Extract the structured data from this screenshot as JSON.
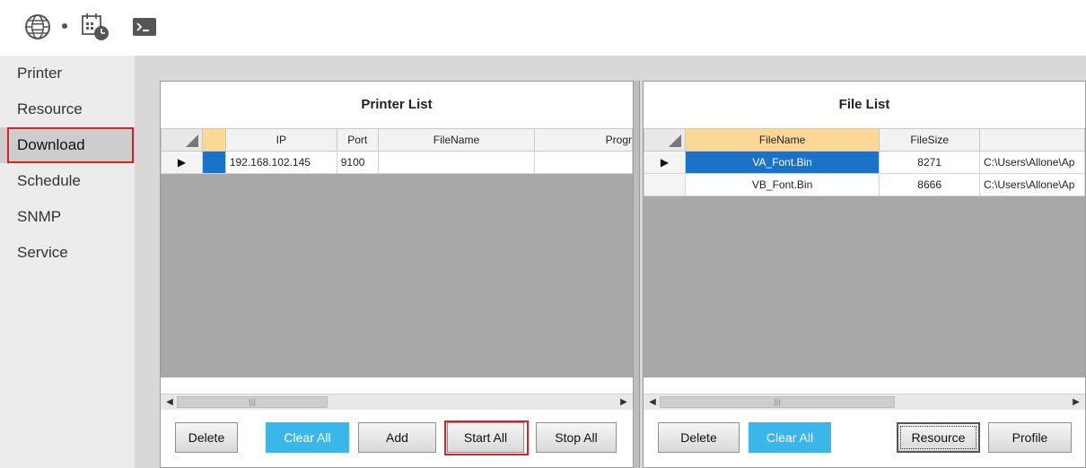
{
  "toolbar": {
    "icons": [
      "globe-language-icon",
      "dropdown-dot-icon",
      "calendar-clock-icon",
      "terminal-icon"
    ]
  },
  "sidebar": {
    "items": [
      {
        "label": "Printer",
        "active": false
      },
      {
        "label": "Resource",
        "active": false
      },
      {
        "label": "Download",
        "active": true
      },
      {
        "label": "Schedule",
        "active": false
      },
      {
        "label": "SNMP",
        "active": false
      },
      {
        "label": "Service",
        "active": false
      }
    ]
  },
  "printer_list": {
    "title": "Printer List",
    "columns": [
      "IP",
      "Port",
      "FileName",
      "Progr"
    ],
    "rows": [
      {
        "ip": "192.168.102.145",
        "port": "9100",
        "filename": "",
        "progress": ""
      }
    ],
    "buttons": {
      "delete": "Delete",
      "clear_all": "Clear All",
      "add": "Add",
      "start_all": "Start All",
      "stop_all": "Stop All"
    }
  },
  "file_list": {
    "title": "File List",
    "columns": [
      "FileName",
      "FileSize",
      ""
    ],
    "rows": [
      {
        "filename": "VA_Font.Bin",
        "filesize": "8271",
        "path": "C:\\Users\\Allone\\Ap"
      },
      {
        "filename": "VB_Font.Bin",
        "filesize": "8666",
        "path": "C:\\Users\\Allone\\Ap"
      }
    ],
    "buttons": {
      "delete": "Delete",
      "clear_all": "Clear All",
      "resource": "Resource",
      "profile": "Profile"
    }
  },
  "colors": {
    "accent_blue": "#3ab6e8",
    "selection_blue": "#1a73c8",
    "highlight_red": "#e02020",
    "header_orange": "#fcd896"
  }
}
